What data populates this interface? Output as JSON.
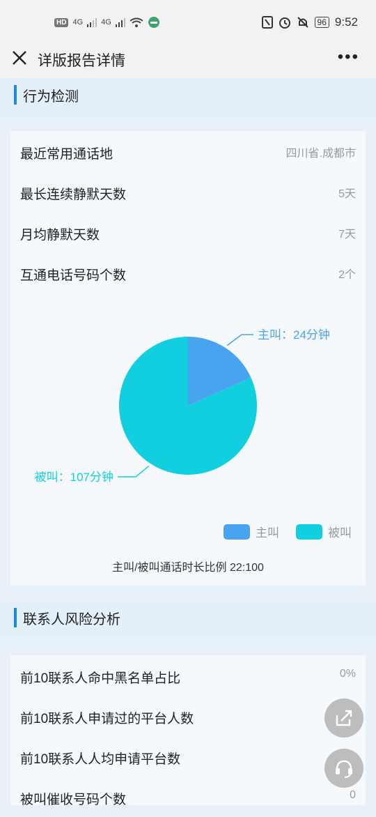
{
  "status_bar": {
    "network_badge": "HD",
    "signal_1": "4G",
    "signal_2": "4G",
    "battery": "96",
    "time": "9:52"
  },
  "nav": {
    "title": "详版报告详情",
    "more": "•••"
  },
  "behavior": {
    "section_title": "行为检测",
    "rows": [
      {
        "label": "最近常用通话地",
        "value": "四川省.成都市"
      },
      {
        "label": "最长连续静默天数",
        "value": "5天"
      },
      {
        "label": "月均静默天数",
        "value": "7天"
      },
      {
        "label": "互通电话号码个数",
        "value": "2个"
      }
    ]
  },
  "chart_data": {
    "type": "pie",
    "slices": [
      {
        "name": "主叫",
        "value": 24,
        "label": "主叫：24分钟",
        "color": "#4aa3ef"
      },
      {
        "name": "被叫",
        "value": 107,
        "label": "被叫：107分钟",
        "color": "#12cfe0"
      }
    ],
    "legend": [
      "主叫",
      "被叫"
    ],
    "legend_position": "bottom-right"
  },
  "ratio_text": "主叫/被叫通话时长比例 22:100",
  "contacts": {
    "section_title": "联系人风险分析",
    "rows": [
      {
        "label": "前10联系人命中黑名单占比",
        "value": "0%"
      },
      {
        "label": "前10联系人申请过的平台人数",
        "value": ""
      },
      {
        "label": "前10联系人人均申请平台数",
        "value": ""
      },
      {
        "label": "被叫催收号码个数",
        "value": "0"
      }
    ]
  },
  "icons": {
    "close": "close-icon",
    "more": "more-icon",
    "share": "share-icon",
    "support": "headset-icon"
  }
}
